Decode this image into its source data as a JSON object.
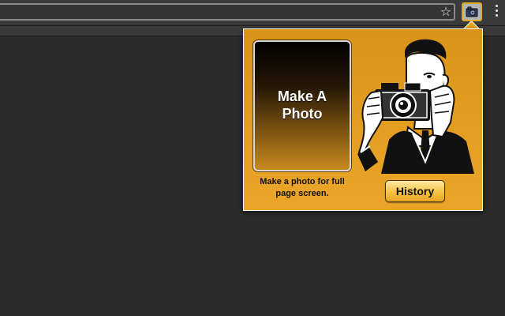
{
  "browser": {
    "address_value": "",
    "bookmark_star_icon": "star-icon",
    "extension_icon": "camera-icon",
    "menu_icon": "kebab-menu-icon"
  },
  "popup": {
    "make_photo_label": "Make A\nPhoto",
    "make_photo_description": "Make a photo for full page screen.",
    "history_label": "History",
    "illustration": "man-with-camera-illustration"
  },
  "colors": {
    "popup_background": "#e3a624",
    "page_background": "#2b2b2b",
    "toolbar": "#3a3a3a"
  }
}
